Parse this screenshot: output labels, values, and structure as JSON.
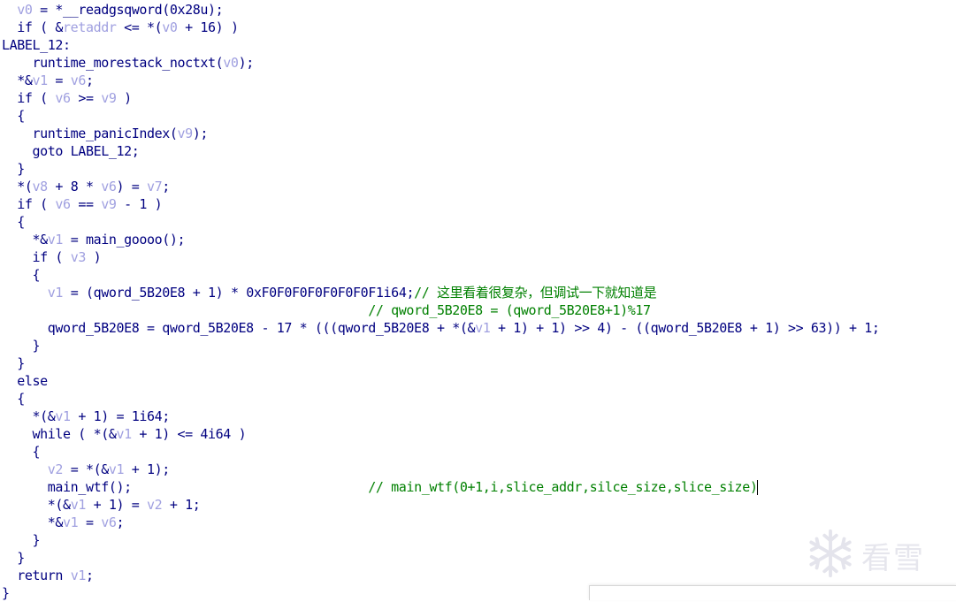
{
  "colors": {
    "background": "#ffffff",
    "code_text": "#000080",
    "variable": "#a0a0e0",
    "comment": "#008000"
  },
  "code_lines": [
    [
      {
        "t": "  "
      },
      {
        "t": "v0",
        "c": "var"
      },
      {
        "t": " = *__readgsqword(0x28u);"
      }
    ],
    [
      {
        "t": "  if ( &"
      },
      {
        "t": "retaddr",
        "c": "var"
      },
      {
        "t": " <= *("
      },
      {
        "t": "v0",
        "c": "var"
      },
      {
        "t": " + 16) )"
      }
    ],
    [
      {
        "t": "LABEL_12:"
      }
    ],
    [
      {
        "t": "    runtime_morestack_noctxt("
      },
      {
        "t": "v0",
        "c": "var"
      },
      {
        "t": ");"
      }
    ],
    [
      {
        "t": "  *&"
      },
      {
        "t": "v1",
        "c": "var"
      },
      {
        "t": " = "
      },
      {
        "t": "v6",
        "c": "var"
      },
      {
        "t": ";"
      }
    ],
    [
      {
        "t": "  if ( "
      },
      {
        "t": "v6",
        "c": "var"
      },
      {
        "t": " >= "
      },
      {
        "t": "v9",
        "c": "var"
      },
      {
        "t": " )"
      }
    ],
    [
      {
        "t": "  {"
      }
    ],
    [
      {
        "t": "    runtime_panicIndex("
      },
      {
        "t": "v9",
        "c": "var"
      },
      {
        "t": ");"
      }
    ],
    [
      {
        "t": "    goto LABEL_12;"
      }
    ],
    [
      {
        "t": "  }"
      }
    ],
    [
      {
        "t": "  *("
      },
      {
        "t": "v8",
        "c": "var"
      },
      {
        "t": " + 8 * "
      },
      {
        "t": "v6",
        "c": "var"
      },
      {
        "t": ") = "
      },
      {
        "t": "v7",
        "c": "var"
      },
      {
        "t": ";"
      }
    ],
    [
      {
        "t": "  if ( "
      },
      {
        "t": "v6",
        "c": "var"
      },
      {
        "t": " == "
      },
      {
        "t": "v9",
        "c": "var"
      },
      {
        "t": " - 1 )"
      }
    ],
    [
      {
        "t": "  {"
      }
    ],
    [
      {
        "t": "    *&"
      },
      {
        "t": "v1",
        "c": "var"
      },
      {
        "t": " = main_goooo();"
      }
    ],
    [
      {
        "t": "    if ( "
      },
      {
        "t": "v3",
        "c": "var"
      },
      {
        "t": " )"
      }
    ],
    [
      {
        "t": "    {"
      }
    ],
    [
      {
        "t": "      "
      },
      {
        "t": "v1",
        "c": "var"
      },
      {
        "t": " = (qword_5B20E8 + 1) * 0xF0F0F0F0F0F0F0F1i64;"
      },
      {
        "t": "// 这里看着很复杂，但调试一下就知道是",
        "c": "cmt"
      }
    ],
    [
      {
        "t": "                                                ",
        "c": "cmt"
      },
      {
        "t": "// qword_5B20E8 = (qword_5B20E8+1)%17",
        "c": "cmt"
      }
    ],
    [
      {
        "t": "      qword_5B20E8 = qword_5B20E8 - 17 * (((qword_5B20E8 + *(&"
      },
      {
        "t": "v1",
        "c": "var"
      },
      {
        "t": " + 1) + 1) >> 4) - ((qword_5B20E8 + 1) >> 63)) + 1;"
      }
    ],
    [
      {
        "t": "    }"
      }
    ],
    [
      {
        "t": "  }"
      }
    ],
    [
      {
        "t": "  else"
      }
    ],
    [
      {
        "t": "  {"
      }
    ],
    [
      {
        "t": "    *(&"
      },
      {
        "t": "v1",
        "c": "var"
      },
      {
        "t": " + 1) = 1i64;"
      }
    ],
    [
      {
        "t": "    while ( *(&"
      },
      {
        "t": "v1",
        "c": "var"
      },
      {
        "t": " + 1) <= 4i64 )"
      }
    ],
    [
      {
        "t": "    {"
      }
    ],
    [
      {
        "t": "      "
      },
      {
        "t": "v2",
        "c": "var"
      },
      {
        "t": " = *(&"
      },
      {
        "t": "v1",
        "c": "var"
      },
      {
        "t": " + 1);"
      }
    ],
    [
      {
        "t": "      main_wtf();                               "
      },
      {
        "t": "// main_wtf(0+1,i,slice_addr,silce_size,slice_size)",
        "c": "cmt"
      }
    ],
    [
      {
        "t": "      *(&"
      },
      {
        "t": "v1",
        "c": "var"
      },
      {
        "t": " + 1) = "
      },
      {
        "t": "v2",
        "c": "var"
      },
      {
        "t": " + 1;"
      }
    ],
    [
      {
        "t": "      *&"
      },
      {
        "t": "v1",
        "c": "var"
      },
      {
        "t": " = "
      },
      {
        "t": "v6",
        "c": "var"
      },
      {
        "t": ";"
      }
    ],
    [
      {
        "t": "    }"
      }
    ],
    [
      {
        "t": "  }"
      }
    ],
    [
      {
        "t": "  return "
      },
      {
        "t": "v1",
        "c": "var"
      },
      {
        "t": ";"
      }
    ],
    [
      {
        "t": "}"
      }
    ]
  ],
  "cursor_line": 27,
  "watermark": {
    "icon": "snowflake-icon",
    "text": "看雪"
  }
}
